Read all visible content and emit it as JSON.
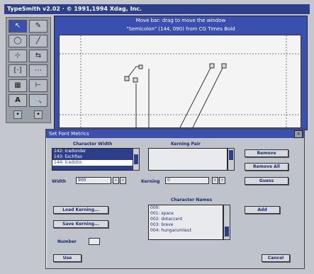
{
  "window": {
    "title": "TypeSmith v2.02 · © 1991,1994 Xdag, Inc."
  },
  "editor": {
    "hint": "Move bar: drag to move the window",
    "subtitle": "\"Semicolon\" (144, 090) from CG Times Bold"
  },
  "toolbox": {
    "icons": [
      "arrow-icon",
      "pen-icon",
      "ellipse-icon",
      "curve-icon",
      "node-icon",
      "split-icon",
      "bracket-icon",
      "hint-icon",
      "grid-icon",
      "metrics-icon",
      "text-tool-icon",
      "magnify-icon"
    ],
    "tool_glyphs": [
      "↖",
      "✎",
      "◯",
      "╱",
      "⊹",
      "⇆",
      "[·]",
      "⋯",
      "▦",
      "⊢",
      "A",
      "🔍"
    ],
    "dots": [
      "•",
      "•"
    ],
    "dot_icons": [
      "left-dot-icon",
      "right-dot-icon"
    ]
  },
  "dialog": {
    "title": "Set Font Metrics",
    "close": "×",
    "char_width_label": "Character Width",
    "kerning_pair_label": "Kerning Pair",
    "char_list": [
      "142: Icedonder",
      "143: Eschfias",
      "144: Icedotio"
    ],
    "width_label": "Width",
    "width_value": "900",
    "kerning_label": "Kerning",
    "kerning_value": "0",
    "buttons": {
      "remove": "Remove",
      "remove_all": "Remove All",
      "guess": "Guess",
      "load_kerning": "Load Kerning...",
      "save_kerning": "Save Kerning...",
      "add": "Add",
      "use": "Use",
      "cancel": "Cancel"
    },
    "char_names_label": "Character Names",
    "char_names": [
      "000:",
      "001: space",
      "002: dotaccent",
      "003: breve",
      "004: hungarumlaut"
    ],
    "number_label": "Number",
    "spin_minus": "‹",
    "spin_plus": "›"
  },
  "colors": {
    "accent": "#3a4fb0",
    "titlebar": "#2d3f8a"
  }
}
